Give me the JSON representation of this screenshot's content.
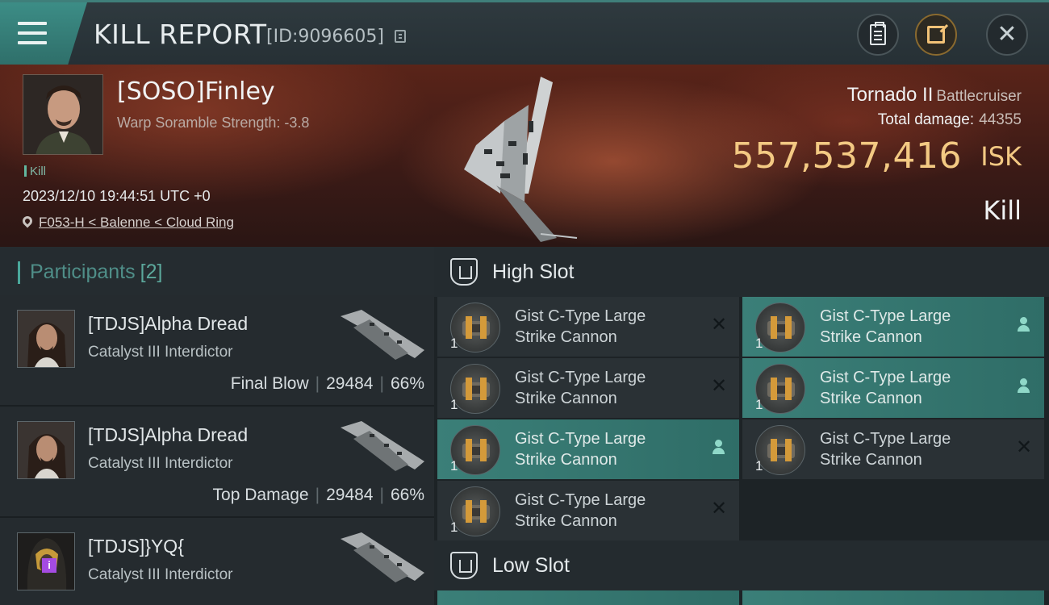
{
  "header": {
    "title": "KILL REPORT",
    "report_id": "[ID:9096605]",
    "icons": {
      "menu": "hamburger-menu-icon",
      "copy": "copy-icon",
      "clipboard": "clipboard-icon",
      "share": "share-icon",
      "close": "close-icon"
    }
  },
  "victim": {
    "name": "[SOSO]Finley",
    "warp_scramble": "Warp Soramble Strength: -3.8",
    "tag": "Kill",
    "datetime": "2023/12/10 19:44:51 UTC +0",
    "location": "F053-H < Balenne < Cloud Ring",
    "ship_name": "Tornado II",
    "ship_class": "Battlecruiser",
    "total_damage_label": "Total damage:",
    "total_damage": "44355",
    "isk_value": "557,537,416",
    "isk_unit": "ISK",
    "result": "Kill"
  },
  "participants": {
    "label": "Participants",
    "count": "[2]",
    "rows": [
      {
        "name": "[TDJS]Alpha Dread",
        "ship": "Catalyst III Interdictor",
        "role": "Final Blow",
        "damage": "29484",
        "percent": "66%"
      },
      {
        "name": "[TDJS]Alpha Dread",
        "ship": "Catalyst III Interdictor",
        "role": "Top Damage",
        "damage": "29484",
        "percent": "66%"
      },
      {
        "name": "[TDJS]}YQ{",
        "ship": "Catalyst III Interdictor",
        "badge": "i"
      }
    ]
  },
  "slots": {
    "high_label": "High Slot",
    "low_label": "Low Slot",
    "high_modules": [
      {
        "line1": "Gist C-Type Large",
        "line2": "Strike Cannon",
        "qty": "1",
        "status": "destroyed"
      },
      {
        "line1": "Gist C-Type Large",
        "line2": "Strike Cannon",
        "qty": "1",
        "status": "dropped"
      },
      {
        "line1": "Gist C-Type Large",
        "line2": "Strike Cannon",
        "qty": "1",
        "status": "destroyed"
      },
      {
        "line1": "Gist C-Type Large",
        "line2": "Strike Cannon",
        "qty": "1",
        "status": "dropped"
      },
      {
        "line1": "Gist C-Type Large",
        "line2": "Strike Cannon",
        "qty": "1",
        "status": "dropped"
      },
      {
        "line1": "Gist C-Type Large",
        "line2": "Strike Cannon",
        "qty": "1",
        "status": "destroyed"
      },
      {
        "line1": "Gist C-Type Large",
        "line2": "Strike Cannon",
        "qty": "1",
        "status": "destroyed"
      }
    ]
  },
  "colors": {
    "accent": "#3c8d86",
    "isk": "#f3c983",
    "dropped": "#3b7f78"
  }
}
